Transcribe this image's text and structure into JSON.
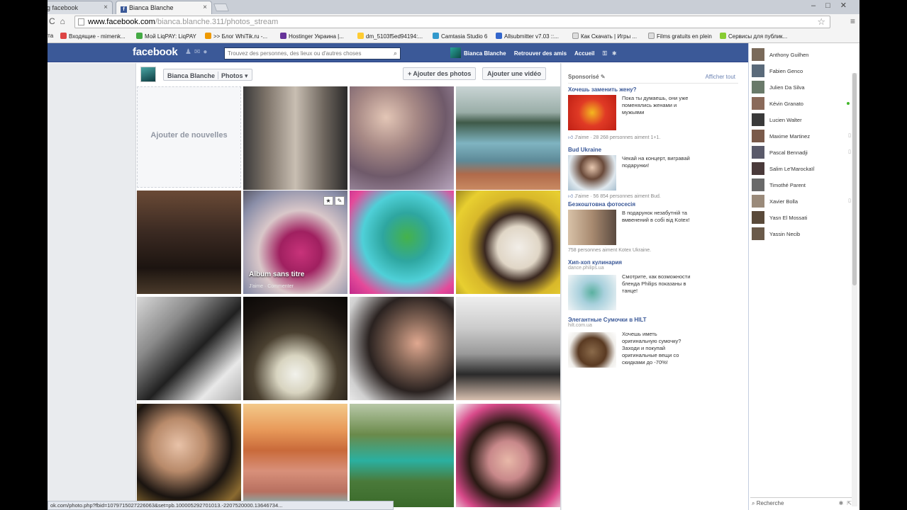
{
  "browser": {
    "tabs": [
      {
        "label": "g facebook",
        "active": false
      },
      {
        "label": "Bianca Blanche",
        "active": true
      }
    ],
    "url_host": "www.facebook.com",
    "url_path": "/bianca.blanche.311/photos_stream",
    "bookmarks": [
      {
        "label": "ета",
        "color": "#888"
      },
      {
        "label": "Входящие - mimenk...",
        "color": "#d44"
      },
      {
        "label": "Мой LiqPAY: LiqPAY",
        "color": "#4a4"
      },
      {
        "label": ">> Блог WhiTik.ru -...",
        "color": "#e90"
      },
      {
        "label": "Hostinger Украина |...",
        "color": "#639"
      },
      {
        "label": "dm_5103f5ed94194:...",
        "color": "#fc3"
      },
      {
        "label": "Camtasia Studio 6",
        "color": "#39c"
      },
      {
        "label": "Allsubmitter v7.03 ::...",
        "color": "#36c"
      },
      {
        "label": "Как Скачать | Игры ...",
        "color": "#ccc"
      },
      {
        "label": "Films gratuits en plein",
        "color": "#ccc"
      },
      {
        "label": "Сервисы для публик...",
        "color": "#8c3"
      }
    ],
    "status_url": "ok.com/photo.php?fbid=1079715027226063&set=pb.100005292701013.-2207520000.13646734..."
  },
  "fb": {
    "logo": "facebook",
    "search_placeholder": "Trouvez des personnes, des lieux ou d'autres choses",
    "user_name": "Bianca Blanche",
    "nav_friends": "Retrouver des amis",
    "nav_home": "Accueil"
  },
  "photos": {
    "owner": "Bianca Blanche",
    "section": "Photos",
    "add_photos": "+ Ajouter des photos",
    "add_video": "Ajouter une vidéo",
    "add_new": "Ajouter de nouvelles",
    "album_title": "Album sans titre",
    "album_actions": "J'aime · Commenter"
  },
  "sponsored": {
    "title": "Sponsorisé",
    "see_all": "Afficher tout",
    "ads": [
      {
        "title": "Хочешь заменить жену?",
        "domain": "",
        "text": "Пока ты думаешь, они уже поменялись женами и мужьями",
        "likes": "J'aime · 28 268 personnes aiment 1+1.",
        "color": "#e03a25"
      },
      {
        "title": "Bud Ukraine",
        "domain": "",
        "text": "Чекай на концерт, вигравай подарунки!",
        "likes": "J'aime · 56 854 personnes aiment Bud.",
        "color": "#b8c7cf"
      },
      {
        "title": "Безкоштовна фотосесія",
        "domain": "",
        "text": "В подарунок незабутній та вмвенений в собі від Kotex!",
        "likes": "758 personnes aiment Kotex Ukraine.",
        "color": "#d7b49a"
      },
      {
        "title": "Хип-хоп кулинария",
        "domain": "dance.philips.ua",
        "text": "Смотрите, как возможности блендa Philips показаны в танце!",
        "likes": "",
        "color": "#8fb6c9"
      },
      {
        "title": "Элегантные Сумочки в HILT",
        "domain": "hilt.com.ua",
        "text": "Хочешь иметь оригинальную сумочку? Заходи и покупай оригинальные вещи со скидками до -70%!",
        "likes": "",
        "color": "#6b4a2e"
      }
    ]
  },
  "chat": {
    "friends": [
      {
        "name": "Anthony Guilhen",
        "status": "",
        "color": "#7a6a5a"
      },
      {
        "name": "Fabien Genco",
        "status": "",
        "color": "#5a6a7a"
      },
      {
        "name": "Julien Da Silva",
        "status": "",
        "color": "#6a7a6a"
      },
      {
        "name": "Kévin Granato",
        "status": "online",
        "color": "#8a6a5a"
      },
      {
        "name": "Lucien Walter",
        "status": "",
        "color": "#3a3a3a"
      },
      {
        "name": "Maxime Martinez",
        "status": "mobile",
        "color": "#7a5a4a"
      },
      {
        "name": "Pascal Bennadji",
        "status": "mobile",
        "color": "#5a5a6a"
      },
      {
        "name": "Salim Le'Marockaïî",
        "status": "",
        "color": "#4a3a3a"
      },
      {
        "name": "Timothé Parent",
        "status": "",
        "color": "#6a6a6a"
      },
      {
        "name": "Xavier Bolla",
        "status": "mobile",
        "color": "#9a8a7a"
      },
      {
        "name": "Yasn El Mossati",
        "status": "",
        "color": "#5a4a3a"
      },
      {
        "name": "Yassin Necib",
        "status": "",
        "color": "#6a5a4a"
      }
    ],
    "search_label": "Recherche"
  }
}
